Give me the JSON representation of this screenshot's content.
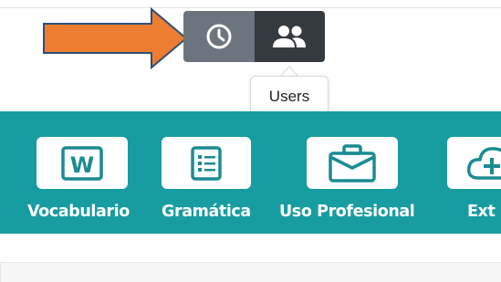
{
  "toolbar": {
    "history_icon": "clock-icon",
    "users_icon": "users-icon",
    "tooltip": "Users"
  },
  "nav": {
    "items": [
      {
        "label": "Vocabulario",
        "icon": "word-document-icon"
      },
      {
        "label": "Gramática",
        "icon": "list-icon"
      },
      {
        "label": "Uso Profesional",
        "icon": "briefcase-icon"
      },
      {
        "label": "Ext",
        "icon": "cloud-add-icon"
      }
    ]
  },
  "colors": {
    "band": "#179ca1",
    "arrow": "#ed7d31",
    "history_button": "#6c757d",
    "users_button": "#343a40"
  }
}
